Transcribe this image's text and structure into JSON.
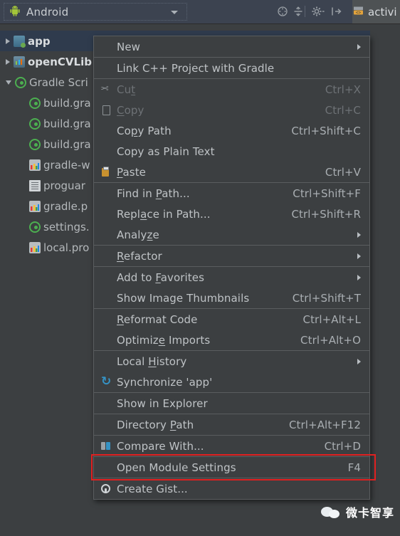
{
  "window": {
    "tool_window_title": "Android",
    "editor_tab_label": "activi",
    "header_icons": [
      {
        "name": "collapse-all-icon",
        "glyph": "⊖"
      },
      {
        "name": "expand-all-icon",
        "glyph": "÷"
      },
      {
        "name": "settings-gear-icon",
        "glyph": "⚙"
      },
      {
        "name": "hide-window-icon",
        "glyph": "⇥"
      }
    ]
  },
  "tree": {
    "items": [
      {
        "label": "app",
        "icon": "module-icon",
        "arrow": "right",
        "indent": 0,
        "bold": true,
        "selected": true
      },
      {
        "label": "openCVLib",
        "icon": "library-icon",
        "arrow": "right",
        "indent": 0,
        "bold": true,
        "selected": false
      },
      {
        "label": "Gradle Scri",
        "icon": "gradle-icon",
        "arrow": "down",
        "indent": 0,
        "bold": false,
        "selected": false
      },
      {
        "label": "build.gra",
        "icon": "gradle-icon",
        "arrow": "none",
        "indent": 1,
        "bold": false,
        "selected": false
      },
      {
        "label": "build.gra",
        "icon": "gradle-icon",
        "arrow": "none",
        "indent": 1,
        "bold": false,
        "selected": false
      },
      {
        "label": "build.gra",
        "icon": "gradle-icon",
        "arrow": "none",
        "indent": 1,
        "bold": false,
        "selected": false
      },
      {
        "label": "gradle-w",
        "icon": "properties-icon",
        "arrow": "none",
        "indent": 1,
        "bold": false,
        "selected": false
      },
      {
        "label": "proguar",
        "icon": "text-file-icon",
        "arrow": "none",
        "indent": 1,
        "bold": false,
        "selected": false
      },
      {
        "label": "gradle.p",
        "icon": "properties-icon",
        "arrow": "none",
        "indent": 1,
        "bold": false,
        "selected": false
      },
      {
        "label": "settings.",
        "icon": "gradle-icon",
        "arrow": "none",
        "indent": 1,
        "bold": false,
        "selected": false
      },
      {
        "label": "local.pro",
        "icon": "properties-icon",
        "arrow": "none",
        "indent": 1,
        "bold": false,
        "selected": false
      }
    ]
  },
  "context_menu": {
    "items": [
      {
        "name": "new",
        "label": "New",
        "shortcut": "",
        "icon": "",
        "submenu": true,
        "disabled": false,
        "sep_after": true
      },
      {
        "name": "link-cpp-project",
        "label": "Link C++ Project with Gradle",
        "shortcut": "",
        "icon": "",
        "submenu": false,
        "disabled": false,
        "sep_after": true
      },
      {
        "name": "cut",
        "label": "Cut",
        "shortcut": "Ctrl+X",
        "icon": "cut-icon",
        "submenu": false,
        "disabled": true,
        "sep_after": false
      },
      {
        "name": "copy",
        "label": "Copy",
        "shortcut": "Ctrl+C",
        "icon": "copy-icon",
        "submenu": false,
        "disabled": true,
        "sep_after": false
      },
      {
        "name": "copy-path",
        "label": "Copy Path",
        "shortcut": "Ctrl+Shift+C",
        "icon": "",
        "submenu": false,
        "disabled": false,
        "sep_after": false
      },
      {
        "name": "copy-as-plain-text",
        "label": "Copy as Plain Text",
        "shortcut": "",
        "icon": "",
        "submenu": false,
        "disabled": false,
        "sep_after": false
      },
      {
        "name": "paste",
        "label": "Paste",
        "shortcut": "Ctrl+V",
        "icon": "paste-icon",
        "submenu": false,
        "disabled": false,
        "sep_after": true
      },
      {
        "name": "find-in-path",
        "label": "Find in Path...",
        "shortcut": "Ctrl+Shift+F",
        "icon": "",
        "submenu": false,
        "disabled": false,
        "sep_after": false
      },
      {
        "name": "replace-in-path",
        "label": "Replace in Path...",
        "shortcut": "Ctrl+Shift+R",
        "icon": "",
        "submenu": false,
        "disabled": false,
        "sep_after": false
      },
      {
        "name": "analyze",
        "label": "Analyze",
        "shortcut": "",
        "icon": "",
        "submenu": true,
        "disabled": false,
        "sep_after": true
      },
      {
        "name": "refactor",
        "label": "Refactor",
        "shortcut": "",
        "icon": "",
        "submenu": true,
        "disabled": false,
        "sep_after": true
      },
      {
        "name": "add-to-favorites",
        "label": "Add to Favorites",
        "shortcut": "",
        "icon": "",
        "submenu": true,
        "disabled": false,
        "sep_after": false
      },
      {
        "name": "show-image-thumbnails",
        "label": "Show Image Thumbnails",
        "shortcut": "Ctrl+Shift+T",
        "icon": "",
        "submenu": false,
        "disabled": false,
        "sep_after": true
      },
      {
        "name": "reformat-code",
        "label": "Reformat Code",
        "shortcut": "Ctrl+Alt+L",
        "icon": "",
        "submenu": false,
        "disabled": false,
        "sep_after": false
      },
      {
        "name": "optimize-imports",
        "label": "Optimize Imports",
        "shortcut": "Ctrl+Alt+O",
        "icon": "",
        "submenu": false,
        "disabled": false,
        "sep_after": true
      },
      {
        "name": "local-history",
        "label": "Local History",
        "shortcut": "",
        "icon": "",
        "submenu": true,
        "disabled": false,
        "sep_after": false
      },
      {
        "name": "synchronize-app",
        "label": "Synchronize 'app'",
        "shortcut": "",
        "icon": "sync-icon",
        "submenu": false,
        "disabled": false,
        "sep_after": true
      },
      {
        "name": "show-in-explorer",
        "label": "Show in Explorer",
        "shortcut": "",
        "icon": "",
        "submenu": false,
        "disabled": false,
        "sep_after": true
      },
      {
        "name": "directory-path",
        "label": "Directory Path",
        "shortcut": "Ctrl+Alt+F12",
        "icon": "",
        "submenu": false,
        "disabled": false,
        "sep_after": true
      },
      {
        "name": "compare-with",
        "label": "Compare With...",
        "shortcut": "Ctrl+D",
        "icon": "compare-icon",
        "submenu": false,
        "disabled": false,
        "sep_after": true
      },
      {
        "name": "open-module-settings",
        "label": "Open Module Settings",
        "shortcut": "F4",
        "icon": "",
        "submenu": false,
        "disabled": false,
        "sep_after": true
      },
      {
        "name": "create-gist",
        "label": "Create Gist...",
        "shortcut": "",
        "icon": "gist-icon",
        "submenu": false,
        "disabled": false,
        "sep_after": false
      }
    ]
  },
  "highlight": {
    "target": "Open Module Settings",
    "color": "#e02020"
  },
  "watermark": {
    "text": "微卡智享"
  },
  "colors": {
    "menu_bg": "#3c3f41",
    "panel_bg": "#3c3f41",
    "header_bg": "#3c4350",
    "selection_bg": "#2f3b4d",
    "separator": "#5a5d5f",
    "text": "#bfc3c6",
    "text_disabled": "#6e7276",
    "accent_red": "#e02020"
  }
}
